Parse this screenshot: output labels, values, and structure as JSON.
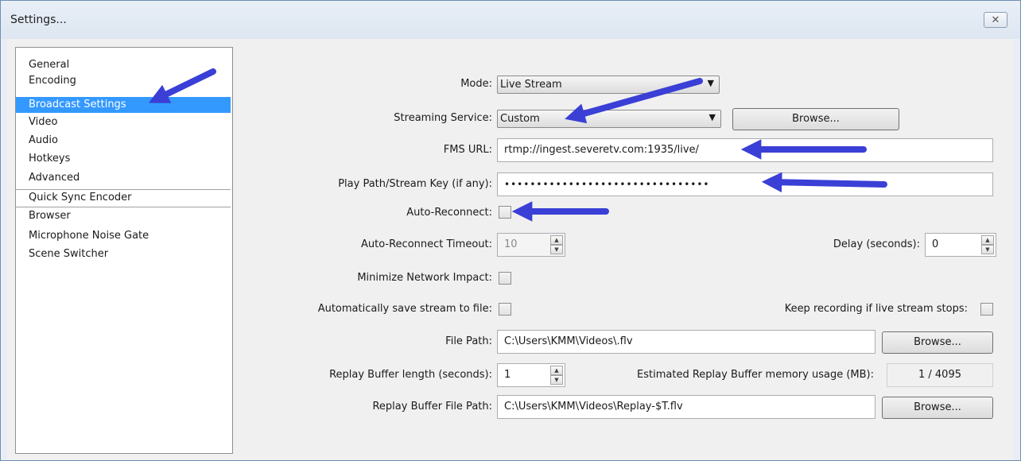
{
  "window": {
    "title": "Settings...",
    "close_glyph": "✕"
  },
  "sidebar": {
    "items": [
      {
        "label": "General"
      },
      {
        "label": "Encoding"
      },
      {
        "label": "Broadcast Settings",
        "selected": true
      },
      {
        "label": "Video"
      },
      {
        "label": "Audio"
      },
      {
        "label": "Hotkeys"
      },
      {
        "label": "Advanced"
      },
      {
        "label": "Quick Sync Encoder"
      },
      {
        "label": "Browser"
      },
      {
        "label": "Microphone Noise Gate"
      },
      {
        "label": "Scene Switcher"
      }
    ]
  },
  "form": {
    "mode": {
      "label": "Mode:",
      "value": "Live Stream"
    },
    "streaming_service": {
      "label": "Streaming Service:",
      "value": "Custom",
      "browse": "Browse..."
    },
    "fms_url": {
      "label": "FMS URL:",
      "value": "rtmp://ingest.severetv.com:1935/live/"
    },
    "stream_key": {
      "label": "Play Path/Stream Key (if any):",
      "value": "••••••••••••••••••••••••••••••••"
    },
    "auto_reconnect": {
      "label": "Auto-Reconnect:",
      "checked": false
    },
    "auto_reconnect_timeout": {
      "label": "Auto-Reconnect Timeout:",
      "value": "10"
    },
    "delay": {
      "label": "Delay (seconds):",
      "value": "0"
    },
    "minimize_network": {
      "label": "Minimize Network Impact:",
      "checked": false
    },
    "auto_save": {
      "label": "Automatically save stream to file:",
      "checked": false
    },
    "keep_recording": {
      "label": "Keep recording if live stream stops:",
      "checked": false
    },
    "file_path": {
      "label": "File Path:",
      "value": "C:\\Users\\KMM\\Videos\\.flv",
      "browse": "Browse..."
    },
    "replay_buffer_length": {
      "label": "Replay Buffer length (seconds):",
      "value": "1"
    },
    "replay_memory": {
      "label": "Estimated Replay Buffer memory usage (MB):",
      "value": "1 / 4095"
    },
    "replay_file_path": {
      "label": "Replay Buffer File Path:",
      "value": "C:\\Users\\KMM\\Videos\\Replay-$T.flv",
      "browse": "Browse..."
    }
  },
  "annotation": {
    "arrow_color": "#3a3fd6"
  }
}
